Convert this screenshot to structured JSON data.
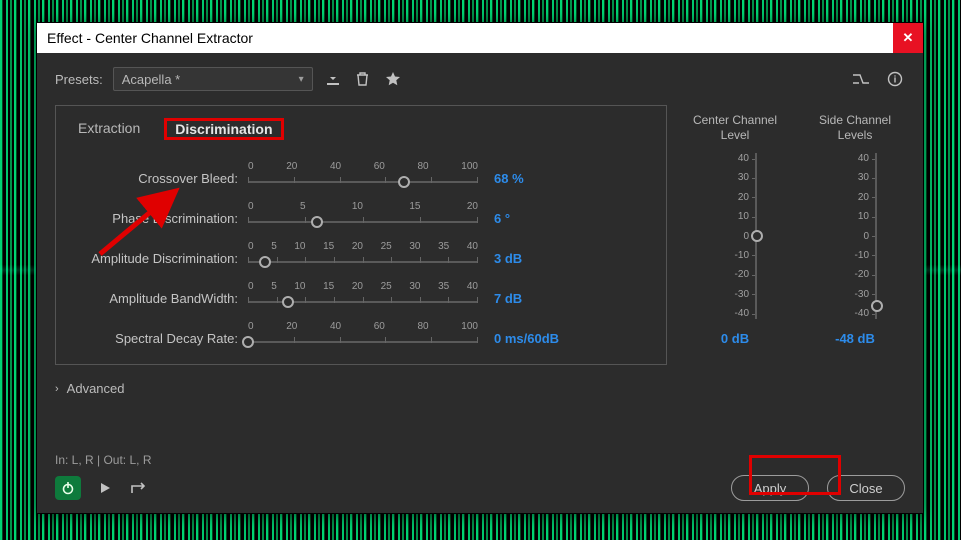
{
  "window": {
    "title": "Effect - Center Channel Extractor"
  },
  "presets": {
    "label": "Presets:",
    "selected": "Acapella *"
  },
  "tabs": {
    "extraction": "Extraction",
    "discrimination": "Discrimination"
  },
  "params": {
    "crossover": {
      "label": "Crossover Bleed:",
      "ticks": [
        "0",
        "20",
        "40",
        "60",
        "80",
        "100"
      ],
      "value": "68 %",
      "pos": 68
    },
    "phase": {
      "label": "Phase Discrimination:",
      "ticks": [
        "0",
        "5",
        "10",
        "15",
        "20"
      ],
      "value": "6 °",
      "pos": 30
    },
    "amplitude": {
      "label": "Amplitude Discrimination:",
      "ticks": [
        "0",
        "5",
        "10",
        "15",
        "20",
        "25",
        "30",
        "35",
        "40"
      ],
      "value": "3 dB",
      "pos": 7.5
    },
    "bandwidth": {
      "label": "Amplitude BandWidth:",
      "ticks": [
        "0",
        "5",
        "10",
        "15",
        "20",
        "25",
        "30",
        "35",
        "40"
      ],
      "value": "7 dB",
      "pos": 17.5
    },
    "spectral": {
      "label": "Spectral Decay Rate:",
      "ticks": [
        "0",
        "20",
        "40",
        "60",
        "80",
        "100"
      ],
      "value": "0 ms/60dB",
      "pos": 0
    }
  },
  "meters": {
    "center": {
      "title": "Center Channel Level",
      "scale": [
        "40",
        "30",
        "20",
        "10",
        "0",
        "-10",
        "-20",
        "-30",
        "-40"
      ],
      "percent": 50,
      "readout": "0 dB"
    },
    "side": {
      "title": "Side Channel Levels",
      "scale": [
        "40",
        "30",
        "20",
        "10",
        "0",
        "-10",
        "-20",
        "-30",
        "-40"
      ],
      "percent": 92,
      "readout": "-48 dB"
    }
  },
  "advanced": {
    "label": "Advanced"
  },
  "footer": {
    "io": "In: L, R | Out: L, R",
    "apply": "Apply",
    "close": "Close"
  }
}
